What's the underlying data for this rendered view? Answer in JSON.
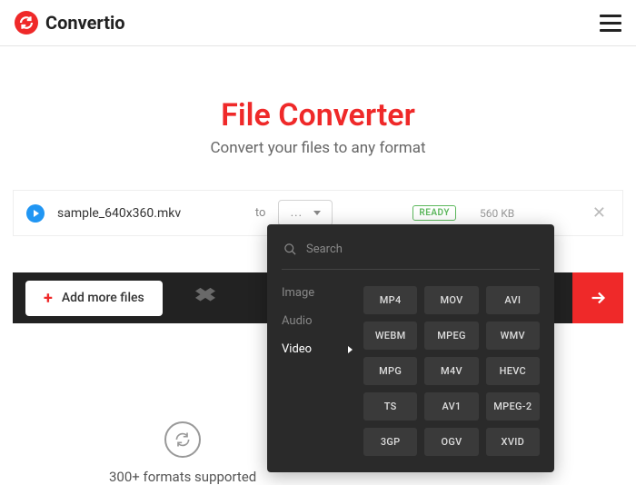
{
  "header": {
    "brand": "Convertio"
  },
  "hero": {
    "title": "File Converter",
    "subtitle": "Convert your files to any format"
  },
  "file": {
    "name": "sample_640x360.mkv",
    "to_label": "to",
    "format_placeholder": "...",
    "status": "READY",
    "size": "560 KB"
  },
  "actions": {
    "add_more": "Add more files"
  },
  "dropdown": {
    "search_placeholder": "Search",
    "categories": {
      "image": "Image",
      "audio": "Audio",
      "video": "Video"
    },
    "formats": [
      "MP4",
      "MOV",
      "AVI",
      "WEBM",
      "MPEG",
      "WMV",
      "MPG",
      "M4V",
      "HEVC",
      "TS",
      "AV1",
      "MPEG-2",
      "3GP",
      "OGV",
      "XVID"
    ]
  },
  "feature": {
    "formats_supported": "300+ formats supported"
  }
}
